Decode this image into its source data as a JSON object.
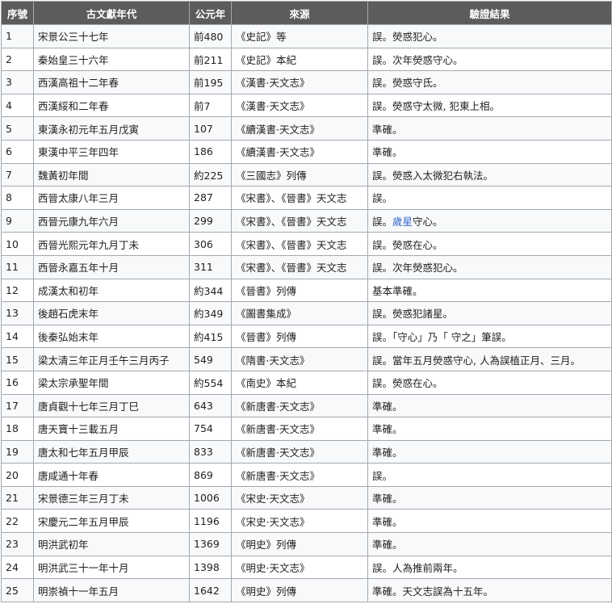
{
  "table": {
    "headers": [
      "序號",
      "古文獻年代",
      "公元年",
      "來源",
      "驗證結果"
    ],
    "rows": [
      {
        "no": "1",
        "era": "宋景公三十七年",
        "year": "前480",
        "source": "《史記》等",
        "result": "誤。熒惑犯心。"
      },
      {
        "no": "2",
        "era": "秦始皇三十六年",
        "year": "前211",
        "source": "《史記》本紀",
        "result": "誤。次年熒惑守心。"
      },
      {
        "no": "3",
        "era": "西漢高祖十二年春",
        "year": "前195",
        "source": "《漢書·天文志》",
        "result": "誤。熒惑守氐。"
      },
      {
        "no": "4",
        "era": "西漢綏和二年春",
        "year": "前7",
        "source": "《漢書·天文志》",
        "result": "誤。熒惑守太微, 犯東上相。"
      },
      {
        "no": "5",
        "era": "東漢永初元年五月戊寅",
        "year": "107",
        "source": "《續漢書·天文志》",
        "result": "準確。"
      },
      {
        "no": "6",
        "era": "東漢中平三年四年",
        "year": "186",
        "source": "《續漢書·天文志》",
        "result": "準確。"
      },
      {
        "no": "7",
        "era": "魏黃初年間",
        "year": "約225",
        "source": "《三國志》列傳",
        "result": "誤。熒惑入太微犯右執法。"
      },
      {
        "no": "8",
        "era": "西晉太康八年三月",
        "year": "287",
        "source": "《宋書》、《晉書》天文志",
        "result": "誤。"
      },
      {
        "no": "9",
        "era": "西晉元康九年六月",
        "year": "299",
        "source": "《宋書》、《晉書》天文志",
        "result": "誤。歲星守心。",
        "result_pre": "誤。",
        "result_link": "歲星",
        "result_post": "守心。"
      },
      {
        "no": "10",
        "era": "西晉光熙元年九月丁未",
        "year": "306",
        "source": "《宋書》、《晉書》天文志",
        "result": "誤。熒惑在心。"
      },
      {
        "no": "11",
        "era": "西晉永嘉五年十月",
        "year": "311",
        "source": "《宋書》、《晉書》天文志",
        "result": "誤。次年熒惑犯心。"
      },
      {
        "no": "12",
        "era": "成漢太和初年",
        "year": "約344",
        "source": "《晉書》列傳",
        "result": "基本準確。"
      },
      {
        "no": "13",
        "era": "後趙石虎末年",
        "year": "約349",
        "source": "《圖書集成》",
        "result": "誤。熒惑犯諸星。"
      },
      {
        "no": "14",
        "era": "後秦弘始末年",
        "year": "約415",
        "source": "《晉書》列傳",
        "result": "誤。「守心」乃「 守之」筆誤。"
      },
      {
        "no": "15",
        "era": "梁太清三年正月壬午三月丙子",
        "year": "549",
        "source": "《隋書·天文志》",
        "result": "誤。當年五月熒惑守心, 人為誤植正月、三月。"
      },
      {
        "no": "16",
        "era": "梁太宗承聖年間",
        "year": "約554",
        "source": "《南史》本紀",
        "result": "誤。熒惑在心。"
      },
      {
        "no": "17",
        "era": "唐貞觀十七年三月丁巳",
        "year": "643",
        "source": "《新唐書·天文志》",
        "result": "準確。"
      },
      {
        "no": "18",
        "era": "唐天寶十三載五月",
        "year": "754",
        "source": "《新唐書·天文志》",
        "result": "準確。"
      },
      {
        "no": "19",
        "era": "唐太和七年五月甲辰",
        "year": "833",
        "source": "《新唐書·天文志》",
        "result": "準確。"
      },
      {
        "no": "20",
        "era": "唐咸通十年春",
        "year": "869",
        "source": "《新唐書·天文志》",
        "result": "誤。"
      },
      {
        "no": "21",
        "era": "宋景德三年三月丁未",
        "year": "1006",
        "source": "《宋史·天文志》",
        "result": "準確。"
      },
      {
        "no": "22",
        "era": "宋慶元二年五月甲辰",
        "year": "1196",
        "source": "《宋史·天文志》",
        "result": "準確。"
      },
      {
        "no": "23",
        "era": "明洪武初年",
        "year": "1369",
        "source": "《明史》列傳",
        "result": "準確。"
      },
      {
        "no": "24",
        "era": "明洪武三十一年十月",
        "year": "1398",
        "source": "《明史·天文志》",
        "result": "誤。人為推前兩年。"
      },
      {
        "no": "25",
        "era": "明崇禎十一年五月",
        "year": "1642",
        "source": "《明史》列傳",
        "result": "準確。天文志誤為十五年。"
      }
    ]
  },
  "colors": {
    "header_bg": "#5c5c5c",
    "header_text": "#ffffff",
    "border": "#a2a9b1",
    "row_odd": "#f8f9fa",
    "row_even": "#ffffff",
    "link": "#3366cc"
  }
}
